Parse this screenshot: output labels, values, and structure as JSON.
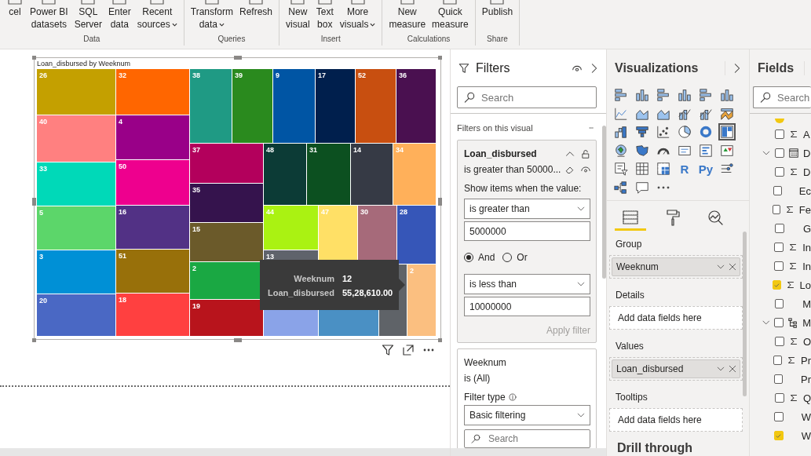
{
  "ribbon": {
    "groups": [
      {
        "label": "Data",
        "buttons": [
          {
            "label": "cel",
            "dropdown": false
          },
          {
            "label": "Power BI\ndatasets",
            "dropdown": false
          },
          {
            "label": "SQL\nServer",
            "dropdown": false
          },
          {
            "label": "Enter\ndata",
            "dropdown": false
          },
          {
            "label": "Recent\nsources",
            "dropdown": true
          }
        ]
      },
      {
        "label": "Queries",
        "buttons": [
          {
            "label": "Transform\ndata",
            "dropdown": true
          },
          {
            "label": "Refresh",
            "dropdown": false
          }
        ]
      },
      {
        "label": "Insert",
        "buttons": [
          {
            "label": "New\nvisual",
            "dropdown": false
          },
          {
            "label": "Text\nbox",
            "dropdown": false
          },
          {
            "label": "More\nvisuals",
            "dropdown": true
          }
        ]
      },
      {
        "label": "Calculations",
        "buttons": [
          {
            "label": "New\nmeasure",
            "dropdown": false
          },
          {
            "label": "Quick\nmeasure",
            "dropdown": false
          }
        ]
      },
      {
        "label": "Share",
        "buttons": [
          {
            "label": "Publish",
            "dropdown": false
          }
        ]
      }
    ]
  },
  "treemap": {
    "title": "Loan_disbursed by Weeknum",
    "tiles": [
      {
        "label": "26",
        "color": "#c4a000"
      },
      {
        "label": "40",
        "color": "#ff8080"
      },
      {
        "label": "33",
        "color": "#00d9b8"
      },
      {
        "label": "5",
        "color": "#5cd66a"
      },
      {
        "label": "3",
        "color": "#0090d6"
      },
      {
        "label": "20",
        "color": "#4a68c4"
      },
      {
        "label": "32",
        "color": "#ff6600"
      },
      {
        "label": "4",
        "color": "#990088"
      },
      {
        "label": "50",
        "color": "#ee008e"
      },
      {
        "label": "16",
        "color": "#523185"
      },
      {
        "label": "51",
        "color": "#98700a"
      },
      {
        "label": "18",
        "color": "#ff4040"
      },
      {
        "label": "38",
        "color": "#1f9a84"
      },
      {
        "label": "39",
        "color": "#2a8a1e"
      },
      {
        "label": "9",
        "color": "#0055a4"
      },
      {
        "label": "17",
        "color": "#001f4d"
      },
      {
        "label": "52",
        "color": "#c84f10"
      },
      {
        "label": "36",
        "color": "#4a1050"
      },
      {
        "label": "37",
        "color": "#b3005c"
      },
      {
        "label": "35",
        "color": "#35134d"
      },
      {
        "label": "15",
        "color": "#6b5a2a"
      },
      {
        "label": "2",
        "color": "#1aa843"
      },
      {
        "label": "19",
        "color": "#b8141c"
      },
      {
        "label": "48",
        "color": "#0c3b36"
      },
      {
        "label": "31",
        "color": "#0c5020"
      },
      {
        "label": "14",
        "color": "#363a45"
      },
      {
        "label": "34",
        "color": "#ffb05a"
      },
      {
        "label": "44",
        "color": "#aaf212"
      },
      {
        "label": "13",
        "color": "#5f636b"
      },
      {
        "label": "47",
        "color": "#ffe066"
      },
      {
        "label": "30",
        "color": "#a66a7a"
      },
      {
        "label": "28",
        "color": "#3656b8"
      },
      {
        "color": "#8aa3e8"
      },
      {
        "color": "#4a90c4"
      },
      {
        "color": "#5f6368"
      },
      {
        "label": "2",
        "color": "#fbbf80"
      }
    ],
    "tooltip": [
      {
        "name": "Weeknum",
        "value": "12"
      },
      {
        "name": "Loan_disbursed",
        "value": "55,28,610.00"
      }
    ]
  },
  "filters": {
    "title": "Filters",
    "search_placeholder": "Search",
    "section": "Filters on this visual",
    "cards": [
      {
        "kind": "advanced",
        "active": true,
        "field": "Loan_disbursed",
        "summary": "is greater than 50000...",
        "prompt": "Show items when the value:",
        "condition1": {
          "operator": "is greater than",
          "value": "5000000"
        },
        "logic": [
          {
            "label": "And",
            "selected": true
          },
          {
            "label": "Or",
            "selected": false
          }
        ],
        "condition2": {
          "operator": "is less than",
          "value": "10000000"
        },
        "apply": "Apply filter",
        "apply_disabled": true
      },
      {
        "kind": "basic",
        "active": false,
        "field": "Weeknum",
        "summary": "is (All)",
        "filter_type_label": "Filter type",
        "filter_type": "Basic filtering",
        "search_placeholder": "Search"
      }
    ]
  },
  "visualizations": {
    "title": "Visualizations",
    "visual_types": [
      {
        "selected": false
      },
      {
        "selected": false
      },
      {
        "selected": false
      },
      {
        "selected": false
      },
      {
        "selected": false
      },
      {
        "selected": false
      },
      {
        "selected": false
      },
      {
        "selected": false
      },
      {
        "selected": false
      },
      {
        "selected": false
      },
      {
        "selected": false
      },
      {
        "selected": false
      },
      {
        "selected": false
      },
      {
        "selected": false
      },
      {
        "selected": false
      },
      {
        "selected": false
      },
      {
        "selected": false
      },
      {
        "selected": true
      },
      {
        "selected": false
      },
      {
        "selected": false
      },
      {
        "selected": false
      },
      {
        "selected": false
      },
      {
        "selected": false
      },
      {
        "selected": false
      },
      {
        "selected": false
      },
      {
        "selected": false
      },
      {
        "selected": false
      },
      {
        "label": "R",
        "selected": false
      },
      {
        "label": "Py",
        "selected": false
      },
      {
        "selected": false
      },
      {
        "selected": false
      },
      {
        "selected": false
      },
      {
        "selected": false
      }
    ],
    "build_tabs": [
      {
        "selected": true
      },
      {
        "selected": false
      },
      {
        "selected": false
      }
    ],
    "wells": [
      {
        "label": "Group",
        "fields": [
          "Weeknum"
        ]
      },
      {
        "label": "Details",
        "placeholder": "Add data fields here"
      },
      {
        "label": "Values",
        "fields": [
          "Loan_disbursed"
        ]
      },
      {
        "label": "Tooltips",
        "placeholder": "Add data fields here"
      }
    ],
    "drill_through": "Drill through"
  },
  "fields": {
    "title": "Fields",
    "search_placeholder": "Search",
    "items": [
      {
        "name": "A",
        "kind": "measure",
        "checked": false
      },
      {
        "name": "D",
        "kind": "date",
        "checked": false,
        "expanded": true
      },
      {
        "name": "D",
        "kind": "measure",
        "checked": false
      },
      {
        "name": "Ec",
        "kind": "text",
        "checked": false
      },
      {
        "name": "Fe",
        "kind": "measure",
        "checked": false
      },
      {
        "name": "G",
        "kind": "text",
        "checked": false
      },
      {
        "name": "In",
        "kind": "measure",
        "checked": false
      },
      {
        "name": "In",
        "kind": "measure",
        "checked": false
      },
      {
        "name": "Lo",
        "kind": "measure",
        "checked": true
      },
      {
        "name": "M",
        "kind": "text",
        "checked": false
      },
      {
        "name": "M",
        "kind": "hierarchy",
        "checked": false,
        "expanded": true
      },
      {
        "name": "O",
        "kind": "measure",
        "checked": false
      },
      {
        "name": "Pr",
        "kind": "measure",
        "checked": false
      },
      {
        "name": "Pr",
        "kind": "text",
        "checked": false
      },
      {
        "name": "Q",
        "kind": "measure",
        "checked": false
      },
      {
        "name": "W",
        "kind": "text",
        "checked": false
      },
      {
        "name": "W",
        "kind": "text",
        "checked": true
      }
    ]
  }
}
